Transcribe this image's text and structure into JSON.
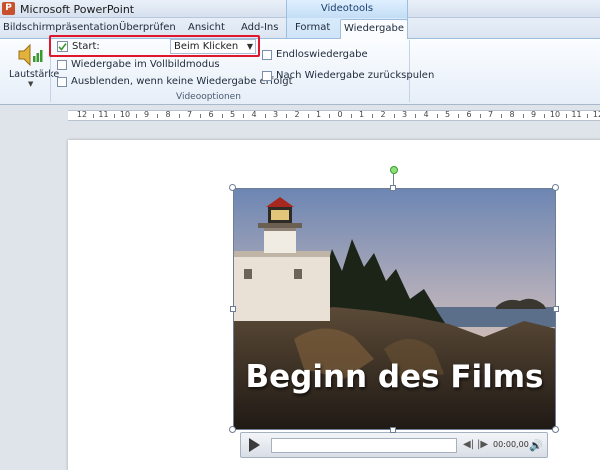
{
  "window": {
    "title": "Microsoft PowerPoint"
  },
  "tabs": {
    "context_header": "Videotools",
    "items": [
      {
        "label": "Bildschirmpräsentation"
      },
      {
        "label": "Überprüfen"
      },
      {
        "label": "Ansicht"
      },
      {
        "label": "Add-Ins"
      },
      {
        "label": "Format"
      }
    ],
    "active": "Wiedergabe"
  },
  "ribbon": {
    "volume_label": "Lautstärke",
    "start_label": "Start:",
    "start_value": "Beim Klicken",
    "fullscreen_label": "Wiedergabe im Vollbildmodus",
    "hide_label": "Ausblenden, wenn keine Wiedergabe erfolgt",
    "loop_label": "Endloswiedergabe",
    "rewind_label": "Nach Wiedergabe zurückspulen",
    "group_label": "Videooptionen"
  },
  "ruler": {
    "labels": [
      "12",
      "11",
      "10",
      "9",
      "8",
      "7",
      "6",
      "5",
      "4",
      "3",
      "2",
      "1",
      "0",
      "1",
      "2",
      "3",
      "4",
      "5",
      "6",
      "7",
      "8",
      "9",
      "10",
      "11",
      "12"
    ]
  },
  "video": {
    "caption": "Beginn des Films",
    "time": "00:00,00"
  },
  "icons": {
    "volume": "speaker-volume-icon",
    "start": "start-trigger-icon",
    "play": "play-icon",
    "step_back": "step-back-icon",
    "step_forward": "step-forward-icon",
    "mute": "speaker-icon"
  }
}
